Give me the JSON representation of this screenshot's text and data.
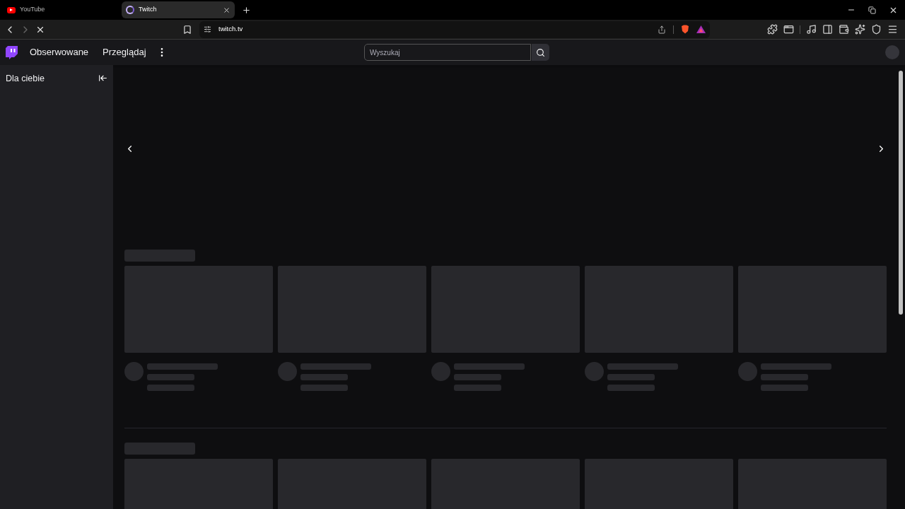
{
  "browser_tabs": [
    {
      "title": "YouTube",
      "selected": false,
      "kind": "youtube"
    },
    {
      "title": "Twitch",
      "selected": true,
      "kind": "twitch"
    }
  ],
  "address_bar": {
    "url": "twitch.tv"
  },
  "nav": {
    "links": [
      "Obserwowane",
      "Przeglądaj"
    ],
    "search": {
      "placeholder": "Wyszukaj"
    }
  },
  "sidebar": {
    "title": "Dla ciebie"
  }
}
